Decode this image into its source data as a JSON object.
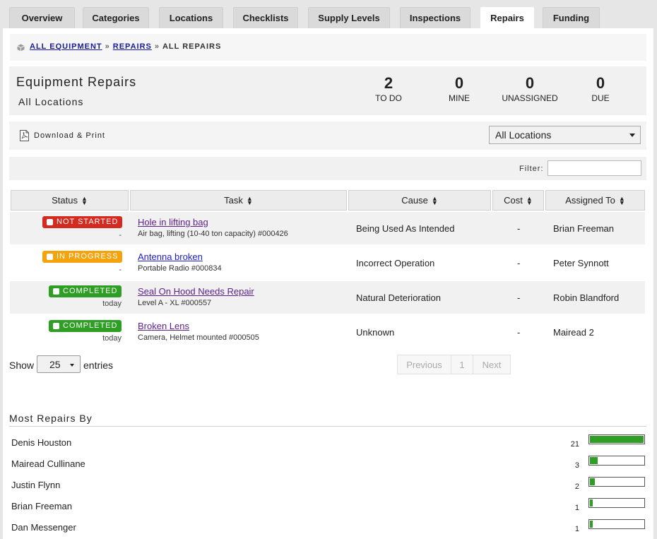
{
  "tabs": [
    {
      "label": "Overview"
    },
    {
      "label": "Categories"
    },
    {
      "label": "Locations"
    },
    {
      "label": "Checklists"
    },
    {
      "label": "Supply Levels"
    },
    {
      "label": "Inspections"
    },
    {
      "label": "Repairs",
      "active": true
    },
    {
      "label": "Funding"
    }
  ],
  "breadcrumb": {
    "items": [
      "ALL EQUIPMENT",
      "REPAIRS"
    ],
    "separator": "»",
    "current": "ALL REPAIRS"
  },
  "summary": {
    "title": "Equipment Repairs",
    "subtitle": "All Locations",
    "stats": [
      {
        "value": "2",
        "label": "TO DO"
      },
      {
        "value": "0",
        "label": "MINE"
      },
      {
        "value": "0",
        "label": "UNASSIGNED"
      },
      {
        "value": "0",
        "label": "DUE"
      }
    ]
  },
  "toolbar": {
    "download_label": "Download & Print",
    "location_select": "All Locations"
  },
  "filter": {
    "label": "Filter:",
    "value": ""
  },
  "table": {
    "columns": [
      "Status",
      "Task",
      "Cause",
      "Cost",
      "Assigned To"
    ],
    "rows": [
      {
        "status": "NOT STARTED",
        "status_type": "not-started",
        "status_note": "-",
        "task": "Hole in lifting bag",
        "task_sub": "Air bag, lifting (10-40 ton capacity) #000426",
        "cause": "Being Used As Intended",
        "cost": "-",
        "assigned": "Brian Freeman"
      },
      {
        "status": "IN PROGRESS",
        "status_type": "in-progress",
        "status_note": "-",
        "task": "Antenna broken",
        "task_sub": "Portable Radio #000834",
        "cause": "Incorrect Operation",
        "cost": "-",
        "assigned": "Peter Synnott"
      },
      {
        "status": "COMPLETED",
        "status_type": "completed",
        "status_note": "today",
        "task": "Seal On Hood Needs Repair",
        "task_sub": "Level A - XL #000557",
        "cause": "Natural Deterioration",
        "cost": "-",
        "assigned": "Robin Blandford"
      },
      {
        "status": "COMPLETED",
        "status_type": "completed",
        "status_note": "today",
        "task": "Broken Lens",
        "task_sub": "Camera, Helmet mounted #000505",
        "cause": "Unknown",
        "cost": "-",
        "assigned": "Mairead 2"
      }
    ]
  },
  "length": {
    "show_label": "Show",
    "value": "25",
    "entries_label": "entries"
  },
  "pagination": {
    "previous": "Previous",
    "page": "1",
    "next": "Next"
  },
  "most_repairs": {
    "title": "Most Repairs By",
    "max": 21,
    "people": [
      {
        "name": "Denis Houston",
        "count": 21
      },
      {
        "name": "Mairead Cullinane",
        "count": 3
      },
      {
        "name": "Justin Flynn",
        "count": 2
      },
      {
        "name": "Brian Freeman",
        "count": 1
      },
      {
        "name": "Dan Messenger",
        "count": 1
      }
    ]
  },
  "colors": {
    "not_started": "#d42a1f",
    "in_progress": "#f5a30c",
    "completed": "#2e9e25",
    "bar_fill": "#2e9e25"
  }
}
